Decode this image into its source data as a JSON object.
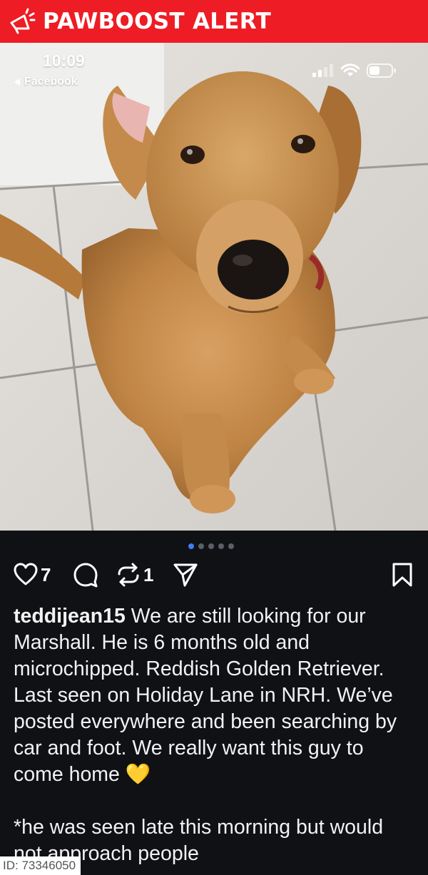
{
  "banner": {
    "title": "PAWBOOST ALERT",
    "color": "#ee1c24",
    "icon": "megaphone-icon"
  },
  "status_bar": {
    "time": "10:09",
    "back_label": "Facebook",
    "icons": [
      "cellular-signal-icon",
      "wifi-icon",
      "battery-icon"
    ]
  },
  "photo": {
    "subject": "dog-photo",
    "carousel_pages": 5,
    "carousel_active": 0
  },
  "actions": {
    "likes": "7",
    "reposts": "1",
    "icons": [
      "heart-icon",
      "comment-icon",
      "repost-icon",
      "send-icon",
      "bookmark-icon"
    ]
  },
  "caption": {
    "username": "teddijean15",
    "text": " We are still looking for our Marshall. He is 6 months old and microchipped. Reddish Golden Retriever. Last seen on Holiday Lane in NRH. We’ve posted everywhere and been searching by car and foot. We really want this guy to come home 💛",
    "note": "*he was seen late this morning but would not approach people"
  },
  "id_tag": "ID: 73346050"
}
